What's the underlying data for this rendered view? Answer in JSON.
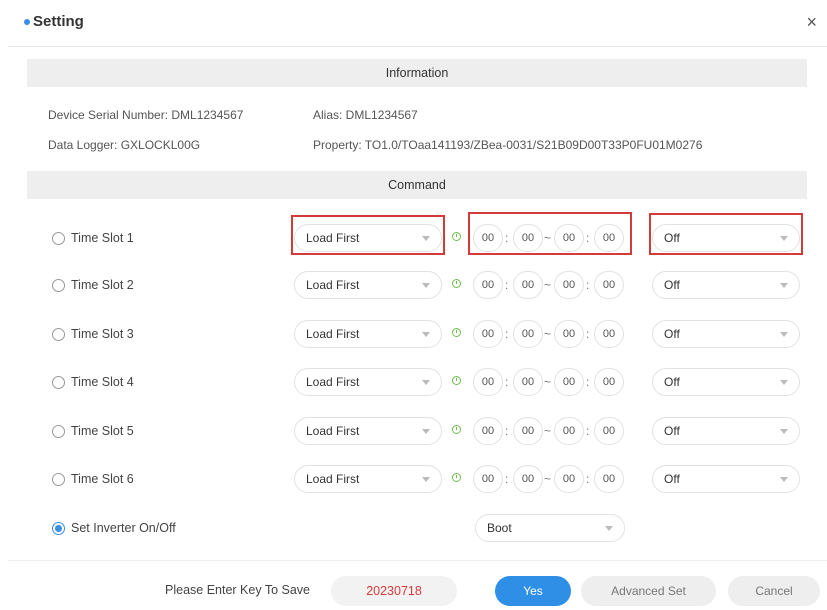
{
  "dialog": {
    "title": "Setting",
    "close_symbol": "×"
  },
  "information": {
    "header": "Information",
    "device_serial": "Device Serial Number: DML1234567",
    "alias": "Alias: DML1234567",
    "data_logger": "Data Logger: GXLOCKL00G",
    "property": "Property: TO1.0/TOaa141193/ZBea-0031/S21B09D00T33P0FU01M0276"
  },
  "command": {
    "header": "Command",
    "time_slots": [
      {
        "label": "Time Slot 1",
        "mode": "Load First",
        "start_h": "00",
        "start_m": "00",
        "end_h": "00",
        "end_m": "00",
        "state": "Off",
        "selected": false
      },
      {
        "label": "Time Slot 2",
        "mode": "Load First",
        "start_h": "00",
        "start_m": "00",
        "end_h": "00",
        "end_m": "00",
        "state": "Off",
        "selected": false
      },
      {
        "label": "Time Slot 3",
        "mode": "Load First",
        "start_h": "00",
        "start_m": "00",
        "end_h": "00",
        "end_m": "00",
        "state": "Off",
        "selected": false
      },
      {
        "label": "Time Slot 4",
        "mode": "Load First",
        "start_h": "00",
        "start_m": "00",
        "end_h": "00",
        "end_m": "00",
        "state": "Off",
        "selected": false
      },
      {
        "label": "Time Slot 5",
        "mode": "Load First",
        "start_h": "00",
        "start_m": "00",
        "end_h": "00",
        "end_m": "00",
        "state": "Off",
        "selected": false
      },
      {
        "label": "Time Slot 6",
        "mode": "Load First",
        "start_h": "00",
        "start_m": "00",
        "end_h": "00",
        "end_m": "00",
        "state": "Off",
        "selected": false
      }
    ],
    "time_colon": ":",
    "time_dash": "~",
    "inverter": {
      "label": "Set Inverter On/Off",
      "value": "Boot",
      "selected": true
    }
  },
  "footer": {
    "key_label": "Please Enter Key To Save",
    "key_value": "20230718",
    "yes_label": "Yes",
    "advanced_label": "Advanced Set",
    "cancel_label": "Cancel"
  },
  "colors": {
    "accent": "#2f8fe6",
    "highlight_red": "#d33a3a",
    "clock_green": "#6cc04a",
    "section_bg": "#eeeeee"
  },
  "icons": [
    "title-dot-icon",
    "close-icon",
    "clock-icon",
    "dropdown-caret-icon",
    "radio-icon"
  ]
}
